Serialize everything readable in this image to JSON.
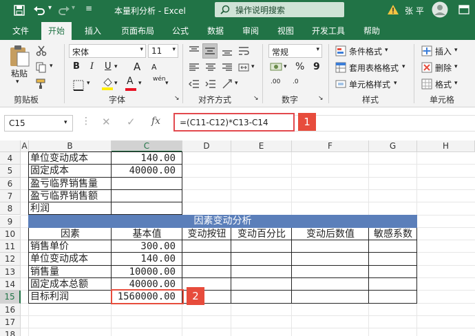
{
  "title": {
    "doc": "本量利分析",
    "sep": "-",
    "app": "Excel",
    "tellme": "操作说明搜索",
    "user": "张 平"
  },
  "tabs": [
    "文件",
    "开始",
    "插入",
    "页面布局",
    "公式",
    "数据",
    "审阅",
    "视图",
    "开发工具",
    "帮助"
  ],
  "ribbon": {
    "clipboard": {
      "paste": "粘贴",
      "group": "剪贴板"
    },
    "font": {
      "name": "宋体",
      "size": "11",
      "group": "字体",
      "bold": "B",
      "italic": "I",
      "underline": "U",
      "grow": "A",
      "shrink": "A",
      "fontcolor": "A",
      "phonetic": "wén"
    },
    "align": {
      "group": "对齐方式"
    },
    "number": {
      "format": "常规",
      "percent": "%",
      "comma": "9",
      "group": "数字",
      "inc": ".00",
      "dec": ".0"
    },
    "styles": {
      "cond": "条件格式",
      "table": "套用表格格式",
      "cell": "单元格样式",
      "group": "样式"
    },
    "cells": {
      "insert": "插入",
      "delete": "删除",
      "format": "格式",
      "group": "单元格"
    }
  },
  "formula_bar": {
    "namebox": "C15",
    "fx": "fx",
    "formula": "=(C11-C12)*C13-C14",
    "badge": "1"
  },
  "columns": [
    "A",
    "B",
    "C",
    "D",
    "E",
    "F",
    "G",
    "H"
  ],
  "rows": [
    {
      "n": "4",
      "b": "单位变动成本",
      "c": "140.00"
    },
    {
      "n": "5",
      "b": "固定成本",
      "c": "40000.00"
    },
    {
      "n": "6",
      "b": "盈亏临界销售量",
      "c": ""
    },
    {
      "n": "7",
      "b": "盈亏临界销售额",
      "c": ""
    },
    {
      "n": "8",
      "b": "利润",
      "c": ""
    },
    {
      "n": "9",
      "b": "",
      "c": ""
    },
    {
      "n": "10",
      "b": "因素",
      "c": "基本值"
    },
    {
      "n": "11",
      "b": "销售单价",
      "c": "300.00"
    },
    {
      "n": "12",
      "b": "单位变动成本",
      "c": "140.00"
    },
    {
      "n": "13",
      "b": "销售量",
      "c": "10000.00"
    },
    {
      "n": "14",
      "b": "固定成本总额",
      "c": "40000.00"
    },
    {
      "n": "15",
      "b": "目标利润",
      "c": "1560000.00"
    },
    {
      "n": "16",
      "b": "",
      "c": ""
    },
    {
      "n": "17",
      "b": "",
      "c": ""
    },
    {
      "n": "18",
      "b": "",
      "c": ""
    }
  ],
  "table": {
    "title": "因素变动分析",
    "h_d": "变动按钮",
    "h_e": "变动百分比",
    "h_f": "变动后数值",
    "h_g": "敏感系数"
  },
  "cell_badge": "2",
  "colors": {
    "excel_green": "#217346",
    "table_blue": "#5b7fba",
    "callout_red": "#e74c3c"
  }
}
